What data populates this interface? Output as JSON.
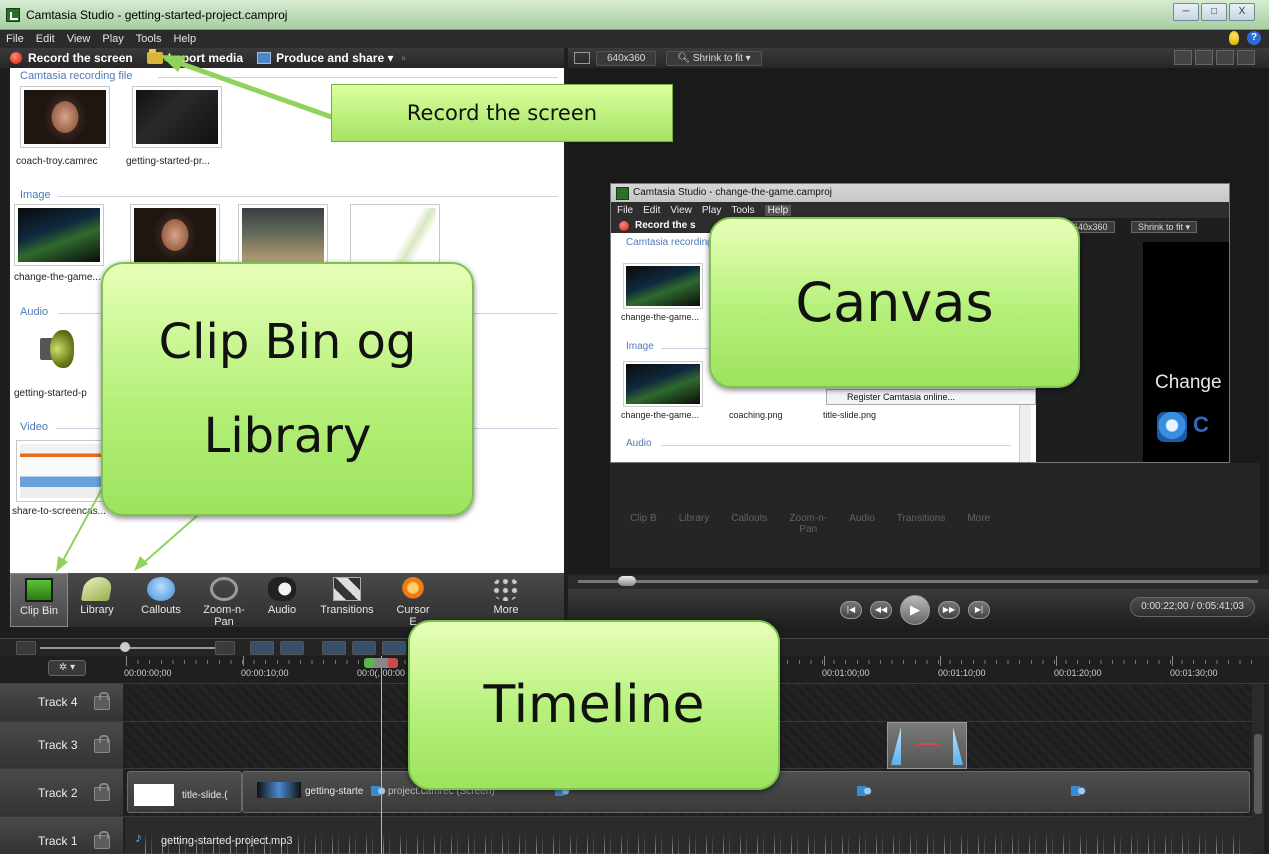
{
  "window": {
    "title": "Camtasia Studio - getting-started-project.camproj",
    "min": "─",
    "max": "□",
    "close": "X"
  },
  "menu": [
    "File",
    "Edit",
    "View",
    "Play",
    "Tools",
    "Help"
  ],
  "toolbar": {
    "record": "Record the screen",
    "import": "Import media",
    "produce": "Produce and share ▾",
    "produce_extra": "▫"
  },
  "clipbin": {
    "sections": [
      {
        "title": "Camtasia recording file",
        "items": [
          "coach-troy.camrec",
          "getting-started-pr..."
        ]
      },
      {
        "title": "Image",
        "items": [
          "change-the-game..."
        ]
      },
      {
        "title": "Audio",
        "items": [
          "getting-started-p"
        ]
      },
      {
        "title": "Video",
        "items": [
          "share-to-screencas..."
        ]
      }
    ]
  },
  "tabs": [
    "Clip Bin",
    "Library",
    "Callouts",
    "Zoom-n-\nPan",
    "Audio",
    "Transitions",
    "Cursor\nE",
    "More"
  ],
  "canvas": {
    "dimensions": "640x360",
    "shrink": "Shrink to fit ▾"
  },
  "embedded": {
    "title": "Camtasia Studio - change-the-game.camproj",
    "menu": [
      "File",
      "Edit",
      "View",
      "Play",
      "Tools",
      "Help"
    ],
    "record": "Record the s",
    "dimensions": "640x360",
    "shrink": "Shrink to fit ▾",
    "section1": "Camtasia recording",
    "section2": "Image",
    "section3": "Audio",
    "label1": "change-the-game...",
    "label2": "change-the-game...",
    "label3": "coaching.png",
    "label4": "title-slide.png",
    "menu_item": "Register Camtasia online...",
    "preview_text": "Change",
    "preview_text2": "C",
    "ghost_tabs": [
      "Clip B",
      "Library",
      "Callouts",
      "Zoom-n-\nPan",
      "Audio",
      "Transitions",
      "More"
    ]
  },
  "playback": {
    "timecode": "0:00:22;00 / 0:05:41;03",
    "skip_back": "|◀",
    "rewind": "◀◀",
    "play": "▶",
    "forward": "▶▶",
    "skip_fwd": "▶|"
  },
  "timeline": {
    "gear": "✲ ▾",
    "ticks": [
      "00:00:00;00",
      "00:00:10;00",
      "00:0(, 00:00",
      "00:01:00;00",
      "00:01:10;00",
      "00:01:20;00",
      "00:01:30;00"
    ],
    "tracks": [
      "Track 4",
      "Track 3",
      "Track 2",
      "Track 1"
    ],
    "clips": {
      "title_slide": "title-slide.(",
      "camrec": "getting-starte",
      "camrec2": "project.camrec (Screen)",
      "audio": "getting-started-project.mp3"
    }
  },
  "annotations": {
    "record": "Record the screen",
    "canvas": "Canvas",
    "clipbin_line1": "Clip Bin og",
    "clipbin_line2": "Library",
    "timeline": "Timeline"
  }
}
